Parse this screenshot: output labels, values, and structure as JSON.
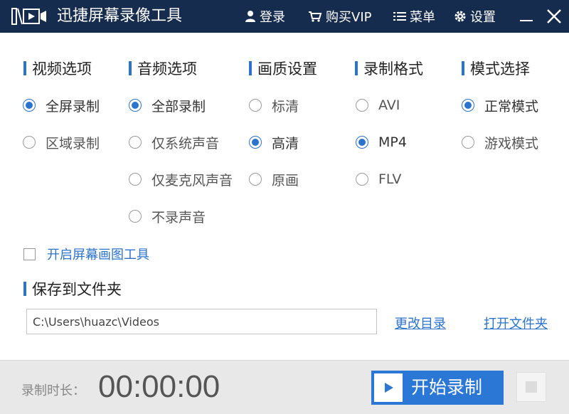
{
  "app": {
    "title": "迅捷屏幕录像工具"
  },
  "toolbar": {
    "login_label": "登录",
    "vip_label": "购买VIP",
    "menu_label": "菜单",
    "settings_label": "设置"
  },
  "icons": {
    "logo": "video-play-icon",
    "login": "user-icon",
    "vip": "cart-icon",
    "menu": "list-icon",
    "settings": "gear-icon",
    "minimize": "minimize-icon",
    "close": "close-icon",
    "start": "play-icon",
    "stop": "stop-icon"
  },
  "colors": {
    "titlebar": "#162c4f",
    "accent": "#2a73cf",
    "start_button": "#2a77d6",
    "footer": "#e8e8e8"
  },
  "sections": {
    "video": {
      "title": "视频选项",
      "options": [
        {
          "label": "全屏录制",
          "checked": true
        },
        {
          "label": "区域录制",
          "checked": false
        }
      ]
    },
    "audio": {
      "title": "音频选项",
      "options": [
        {
          "label": "全部录制",
          "checked": true
        },
        {
          "label": "仅系统声音",
          "checked": false
        },
        {
          "label": "仅麦克风声音",
          "checked": false
        },
        {
          "label": "不录声音",
          "checked": false
        }
      ]
    },
    "quality": {
      "title": "画质设置",
      "options": [
        {
          "label": "标清",
          "checked": false
        },
        {
          "label": "高清",
          "checked": true
        },
        {
          "label": "原画",
          "checked": false
        }
      ]
    },
    "format": {
      "title": "录制格式",
      "options": [
        {
          "label": "AVI",
          "checked": false
        },
        {
          "label": "MP4",
          "checked": true
        },
        {
          "label": "FLV",
          "checked": false
        }
      ]
    },
    "mode": {
      "title": "模式选择",
      "options": [
        {
          "label": "正常模式",
          "checked": true
        },
        {
          "label": "游戏模式",
          "checked": false
        }
      ]
    }
  },
  "drawing_tool": {
    "label": "开启屏幕画图工具",
    "checked": false
  },
  "save": {
    "title": "保存到文件夹",
    "path": "C:\\Users\\huazc\\Videos",
    "change_label": "更改目录",
    "open_label": "打开文件夹"
  },
  "footer": {
    "duration_label": "录制时长：",
    "duration_value": "00:00:00",
    "start_label": "开始录制"
  }
}
